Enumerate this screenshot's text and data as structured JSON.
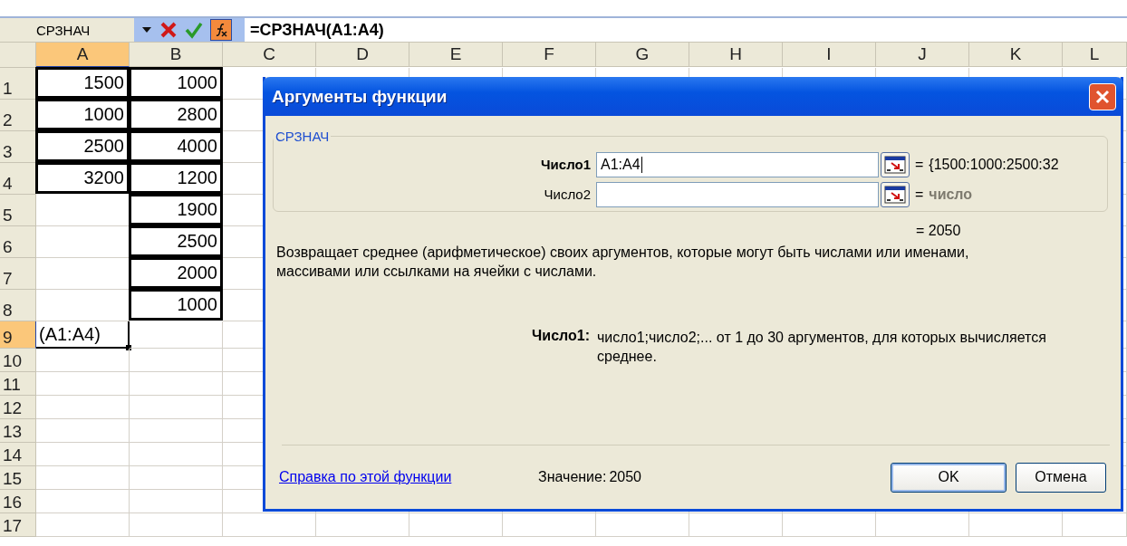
{
  "formula_bar": {
    "name_box": "СРЗНАЧ",
    "formula": "=СРЗНАЧ(A1:A4)"
  },
  "sheet": {
    "columns": [
      {
        "label": "A",
        "selected": true
      },
      {
        "label": "B",
        "selected": false
      },
      {
        "label": "C",
        "selected": false
      },
      {
        "label": "D",
        "selected": false
      },
      {
        "label": "E",
        "selected": false
      },
      {
        "label": "F",
        "selected": false
      },
      {
        "label": "G",
        "selected": false
      },
      {
        "label": "H",
        "selected": false
      },
      {
        "label": "I",
        "selected": false
      },
      {
        "label": "J",
        "selected": false
      },
      {
        "label": "K",
        "selected": false
      },
      {
        "label": "L",
        "selected": false
      }
    ],
    "rows": [
      {
        "number": "1",
        "selected": false,
        "cells": [
          {
            "value": "1500",
            "boxed": true,
            "active": false
          },
          {
            "value": "1000",
            "boxed": true
          }
        ]
      },
      {
        "number": "2",
        "selected": false,
        "cells": [
          {
            "value": "1000",
            "boxed": true,
            "active": false
          },
          {
            "value": "2800",
            "boxed": true,
            "active": false
          }
        ]
      },
      {
        "number": "3",
        "selected": false,
        "cells": [
          {
            "value": "2500",
            "boxed": true,
            "active": false
          },
          {
            "value": "4000",
            "boxed": true,
            "active": false
          }
        ]
      },
      {
        "number": "4",
        "selected": false,
        "cells": [
          {
            "value": "3200",
            "boxed": true,
            "active": false
          },
          {
            "value": "1200",
            "boxed": true,
            "active": false
          }
        ]
      },
      {
        "number": "5",
        "selected": false,
        "cells": [
          null,
          {
            "value": "1900",
            "boxed": true,
            "active": false
          }
        ]
      },
      {
        "number": "6",
        "selected": false,
        "cells": [
          null,
          {
            "value": "2500",
            "boxed": true,
            "active": false
          }
        ]
      },
      {
        "number": "7",
        "selected": false,
        "cells": [
          null,
          {
            "value": "2000",
            "boxed": true,
            "active": false
          }
        ]
      },
      {
        "number": "8",
        "selected": false,
        "cells": [
          null,
          {
            "value": "1000",
            "boxed": true,
            "active": false
          }
        ]
      },
      {
        "number": "9",
        "selected": true,
        "cells": [
          {
            "value": "(A1:A4)",
            "boxed": false,
            "active": true
          }
        ]
      },
      {
        "number": "10",
        "selected": false
      },
      {
        "number": "11",
        "selected": false
      },
      {
        "number": "12",
        "selected": false
      },
      {
        "number": "13",
        "selected": false
      },
      {
        "number": "14",
        "selected": false
      },
      {
        "number": "15",
        "selected": false
      },
      {
        "number": "16",
        "selected": false
      },
      {
        "number": "17",
        "selected": false
      }
    ]
  },
  "dialog": {
    "title": "Аргументы функции",
    "group_label": "СРЗНАЧ",
    "arguments": [
      {
        "label": "Число1",
        "required": true,
        "value": "A1:A4",
        "equals": "=",
        "result": "{1500:1000:2500:32",
        "muted": false
      },
      {
        "label": "Число2",
        "required": false,
        "equals": "=",
        "result": "число",
        "muted": true
      }
    ],
    "total": "= 2050",
    "description": "Возвращает среднее (арифметическое) своих аргументов, которые могут быть числами или именами, массивами или ссылками на ячейки с числами.",
    "argument_help": {
      "label": "Число1:",
      "text": "число1;число2;... от 1 до 30 аргументов, для которых вычисляется среднее."
    },
    "help_link": "Справка по этой функции",
    "value_label": "Значение:",
    "value": "2050",
    "buttons": [
      {
        "label": "OK",
        "default": true
      },
      {
        "label": "Отмена",
        "default": false
      }
    ]
  }
}
